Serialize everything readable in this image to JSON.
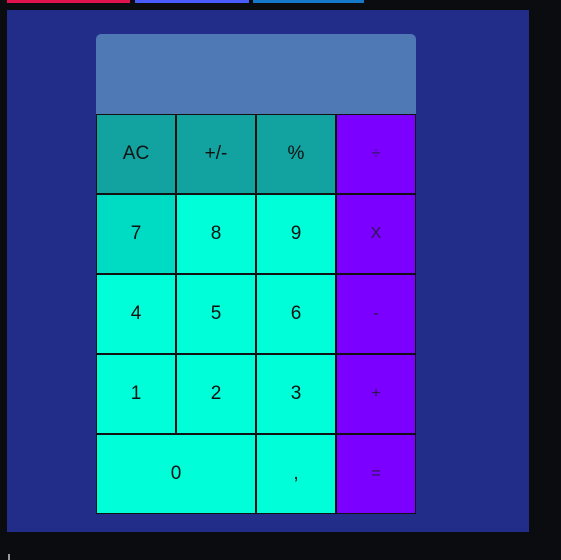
{
  "colors": {
    "page_bg": "#0b0c10",
    "panel_bg": "#222d8a",
    "display_bg": "#4f79b5",
    "fn_key": "#12a3a0",
    "num_key": "#00ffd8",
    "num_key_pressed": "#00dcc4",
    "op_key": "#7b00ff",
    "stripe_1": "#e0134f",
    "stripe_2": "#4b5cff",
    "stripe_3": "#1479c8"
  },
  "display": {
    "value": ""
  },
  "keys": {
    "ac": "AC",
    "plus_minus": "+/-",
    "percent": "%",
    "divide": "÷",
    "seven": "7",
    "eight": "8",
    "nine": "9",
    "multiply": "X",
    "four": "4",
    "five": "5",
    "six": "6",
    "minus": "-",
    "one": "1",
    "two": "2",
    "three": "3",
    "plus": "+",
    "zero": "0",
    "comma": ",",
    "equals": "="
  }
}
